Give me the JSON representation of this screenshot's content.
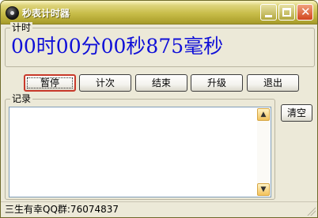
{
  "window": {
    "title": "秒表计时器"
  },
  "timer": {
    "group_label": "计时",
    "display": "00时00分00秒875毫秒",
    "color": "#1010d8"
  },
  "buttons": {
    "pause": "暂停",
    "lap": "计次",
    "stop": "结束",
    "upgrade": "升级",
    "exit": "退出"
  },
  "log": {
    "group_label": "记录",
    "clear": "清空",
    "entries": []
  },
  "status": {
    "text": "三生有幸QQ群:76074837"
  },
  "icons": {
    "app": "app-icon",
    "minimize": "minimize-icon",
    "maximize": "maximize-icon",
    "close": "close-icon",
    "scroll_up": "chevron-up-icon",
    "scroll_down": "chevron-down-icon"
  }
}
